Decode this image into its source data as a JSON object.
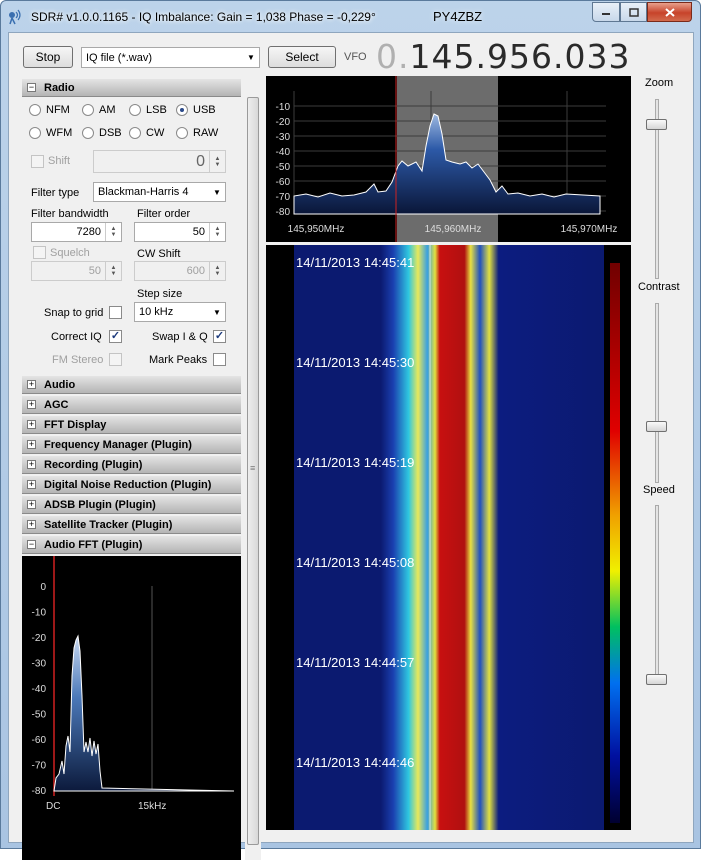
{
  "window": {
    "title": "SDR# v1.0.0.1165 - IQ Imbalance: Gain = 1,038 Phase = -0,229°",
    "callsign": "PY4ZBZ",
    "controls": {
      "minimize": "minimize",
      "maximize": "maximize",
      "close": "close"
    }
  },
  "toolbar": {
    "stop_label": "Stop",
    "source_value": "IQ file (*.wav)",
    "select_label": "Select",
    "vfo_label": "VFO",
    "vfo_dim": "0.",
    "vfo_value": "145.956.033"
  },
  "radio": {
    "header": "Radio",
    "modes": [
      "NFM",
      "AM",
      "LSB",
      "USB",
      "WFM",
      "DSB",
      "CW",
      "RAW"
    ],
    "selected_mode": "USB",
    "shift_label": "Shift",
    "shift_value": "0",
    "filter_type_label": "Filter type",
    "filter_type_value": "Blackman-Harris 4",
    "filter_bandwidth_label": "Filter bandwidth",
    "filter_bandwidth_value": "7280",
    "filter_order_label": "Filter order",
    "filter_order_value": "50",
    "squelch_label": "Squelch",
    "squelch_value": "50",
    "cw_shift_label": "CW Shift",
    "cw_shift_value": "600",
    "step_size_label": "Step size",
    "step_size_value": "10 kHz",
    "snap_label": "Snap to grid",
    "correct_iq_label": "Correct IQ",
    "swap_iq_label": "Swap I & Q",
    "fm_stereo_label": "FM Stereo",
    "mark_peaks_label": "Mark Peaks",
    "snap_checked": false,
    "correct_iq_checked": true,
    "swap_iq_checked": true,
    "fm_stereo_checked": false,
    "mark_peaks_checked": false
  },
  "sections": [
    "Audio",
    "AGC",
    "FFT Display",
    "Frequency Manager (Plugin)",
    "Recording (Plugin)",
    "Digital Noise Reduction (Plugin)",
    "ADSB Plugin (Plugin)",
    "Satellite Tracker (Plugin)",
    "Audio FFT (Plugin)"
  ],
  "spectrum": {
    "y_ticks": [
      "-10",
      "-20",
      "-30",
      "-40",
      "-50",
      "-60",
      "-70",
      "-80"
    ],
    "x_ticks": [
      "145,950MHz",
      "145,960MHz",
      "145,970MHz"
    ]
  },
  "waterfall": {
    "timestamps": [
      "14/11/2013 14:45:41",
      "14/11/2013 14:45:30",
      "14/11/2013 14:45:19",
      "14/11/2013 14:45:08",
      "14/11/2013 14:44:57",
      "14/11/2013 14:44:46"
    ]
  },
  "right_sliders": {
    "zoom_label": "Zoom",
    "contrast_label": "Contrast",
    "speed_label": "Speed",
    "zoom_level": 0.88,
    "contrast_level": 0.3,
    "speed_level": 0.0
  },
  "audio_fft": {
    "y_ticks": [
      "0",
      "-10",
      "-20",
      "-30",
      "-40",
      "-50",
      "-60",
      "-70",
      "-80"
    ],
    "x_ticks": [
      "DC",
      "15kHz"
    ]
  },
  "colors": {
    "spectrum_fill": "#1f3c7a",
    "waterfall_bg": "#0a1a66",
    "marker": "#cc2222"
  }
}
